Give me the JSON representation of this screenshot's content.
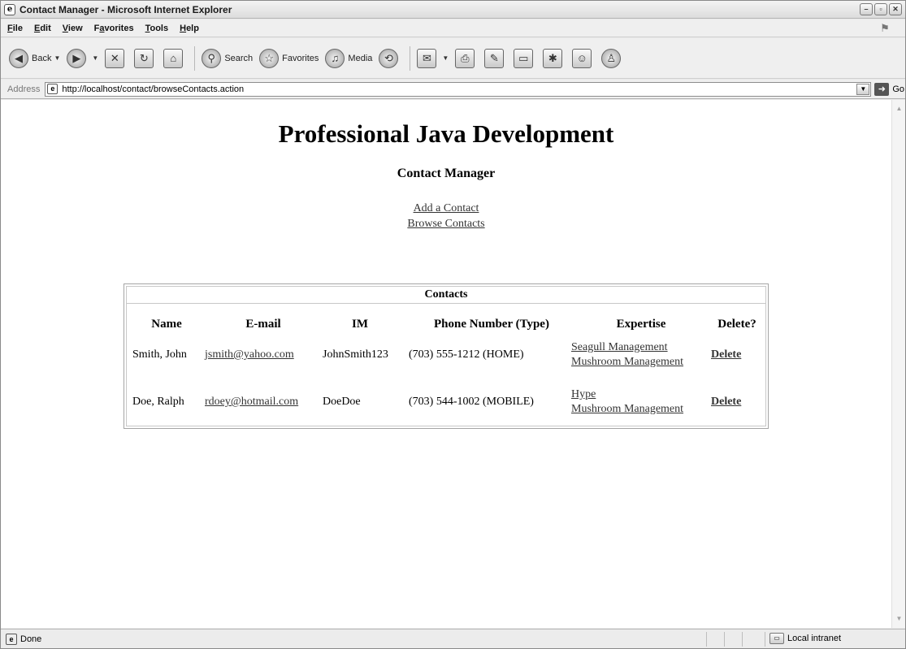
{
  "window": {
    "title": "Contact Manager - Microsoft Internet Explorer",
    "controls": [
      "minimize",
      "maximize",
      "close"
    ]
  },
  "menu": {
    "items": [
      {
        "label": "File",
        "underline": "F",
        "rest": "ile"
      },
      {
        "label": "Edit",
        "underline": "E",
        "rest": "dit"
      },
      {
        "label": "View",
        "underline": "V",
        "rest": "iew"
      },
      {
        "label": "Favorites",
        "underline": "a",
        "prefix": "F",
        "rest": "vorites"
      },
      {
        "label": "Tools",
        "underline": "T",
        "rest": "ools"
      },
      {
        "label": "Help",
        "underline": "H",
        "rest": "elp"
      }
    ]
  },
  "toolbar": {
    "back_label": "Back",
    "search_label": "Search",
    "favorites_label": "Favorites",
    "media_label": "Media"
  },
  "address": {
    "label": "Address",
    "url": "http://localhost/contact/browseContacts.action",
    "go_label": "Go"
  },
  "page": {
    "title": "Professional Java Development",
    "subtitle": "Contact Manager",
    "links": [
      "Add a Contact",
      "Browse Contacts"
    ]
  },
  "contacts_table": {
    "caption": "Contacts",
    "headers": [
      "Name",
      "E-mail",
      "IM",
      "Phone Number (Type)",
      "Expertise",
      "Delete?"
    ],
    "rows": [
      {
        "name": "Smith, John",
        "email": "jsmith@yahoo.com",
        "im": "JohnSmith123",
        "phone": "(703) 555-1212 (HOME)",
        "expertise": [
          "Seagull Management",
          "Mushroom Management"
        ],
        "delete": "Delete"
      },
      {
        "name": "Doe, Ralph",
        "email": "rdoey@hotmail.com",
        "im": "DoeDoe",
        "phone": "(703) 544-1002 (MOBILE)",
        "expertise": [
          "Hype",
          "Mushroom Management"
        ],
        "delete": "Delete"
      }
    ]
  },
  "status": {
    "text": "Done",
    "zone": "Local intranet"
  }
}
